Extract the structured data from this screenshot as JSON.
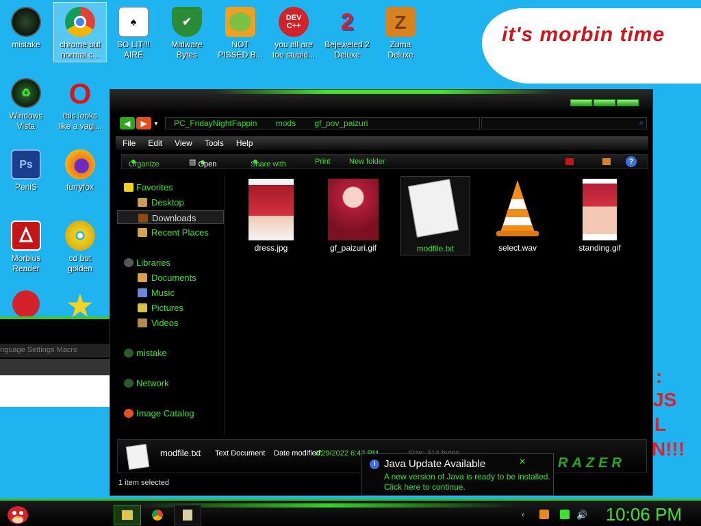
{
  "desktop": {
    "icons": [
      {
        "label": "mistake",
        "glyph": "",
        "color": "#1e3a1e"
      },
      {
        "label": "chrome but normal c...",
        "glyph": "",
        "color": "#f2f2f2"
      },
      {
        "label": "SO LIT!!!\nAIRE",
        "glyph": "♠",
        "color": "#e6e6e6"
      },
      {
        "label": "Malware\nBytes",
        "glyph": "✔",
        "color": "#2c8c36"
      },
      {
        "label": "NOT\nPISSED B...",
        "glyph": "",
        "color": "#7cc143"
      },
      {
        "label": "you all are\ntoo stupid...",
        "glyph": "DEV\nC++",
        "color": "#d3222a"
      },
      {
        "label": "Bejeweled 2\nDeluxe",
        "glyph": "2",
        "color": "#2a4fb4"
      },
      {
        "label": "Zuma\nDeluxe",
        "glyph": "Z",
        "color": "#d98220"
      },
      {
        "label": "Windows\nVista",
        "glyph": "",
        "color": "#1f3a23"
      },
      {
        "label": "this looks\nlike a vagi...",
        "glyph": "O",
        "color": "#d8141c"
      },
      {
        "label": "PeniS",
        "glyph": "Ps",
        "color": "#1a3f8c"
      },
      {
        "label": "furryfox",
        "glyph": "",
        "color": "#f07a1a"
      },
      {
        "label": "Morbius\nReader",
        "glyph": "",
        "color": "#c41616"
      },
      {
        "label": "cd but\ngolden",
        "glyph": "",
        "color": "#f2d21e"
      }
    ],
    "cloud_text": "it's morbin time",
    "partial_text": [
      ":",
      "JS",
      "L",
      "N!!!"
    ]
  },
  "bg_window": {
    "menu": "nguage   Settings   Macro"
  },
  "explorer": {
    "address": [
      "PC_FridayNightFappin",
      "mods",
      "gf_pov_paizuri"
    ],
    "menu": [
      "File",
      "Edit",
      "View",
      "Tools",
      "Help"
    ],
    "commands": {
      "organize": "Organize",
      "open": "Open",
      "share": "Share with",
      "print": "Print",
      "new_folder": "New folder"
    },
    "sidebar": {
      "favorites": "Favorites",
      "desktop": "Desktop",
      "downloads": "Downloads",
      "recent": "Recent Places",
      "libraries": "Libraries",
      "documents": "Documents",
      "music": "Music",
      "pictures": "Pictures",
      "videos": "Videos",
      "mistake": "mistake",
      "network": "Network",
      "catalog": "Image Catalog"
    },
    "files": [
      {
        "name": "dress.jpg"
      },
      {
        "name": "gf_paizuri.gif"
      },
      {
        "name": "modfile.txt"
      },
      {
        "name": "select.wav"
      },
      {
        "name": "standing.gif"
      }
    ],
    "details": {
      "name": "modfile.txt",
      "type": "Text Document",
      "modified_label": "Date modified:",
      "modified": "6/29/2022 6:42 PM",
      "size": "Size: 314 bytes"
    },
    "status": "1 item selected",
    "brand": "RAZER"
  },
  "notification": {
    "title": "Java Update Available",
    "message": "A new version of Java is ready to be installed. Click here to continue."
  },
  "taskbar": {
    "clock": "10:06 PM"
  },
  "colors": {
    "accent": "#3ee12f",
    "desktop_bg": "#1fb4f0"
  }
}
